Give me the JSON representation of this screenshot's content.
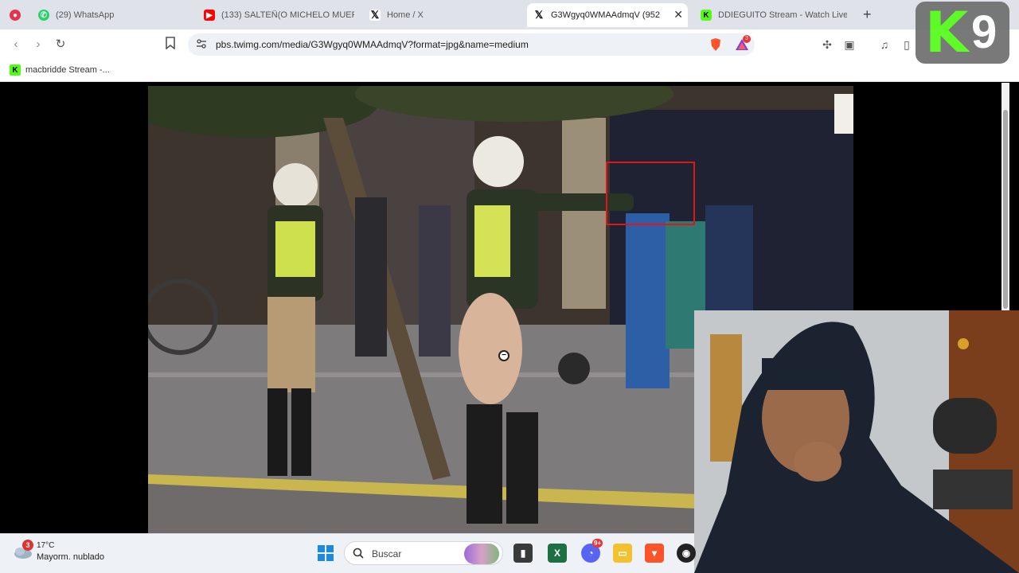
{
  "tabs": [
    {
      "label": "",
      "icon": "record-icon",
      "color": "#e8344a"
    },
    {
      "label": "(29) WhatsApp",
      "icon": "whatsapp-icon",
      "color": "#25d366"
    },
    {
      "label": "(133) SALTEÑ(O MICHELO MUER",
      "icon": "youtube-icon",
      "color": "#ff0000"
    },
    {
      "label": "Home / X",
      "icon": "x-icon",
      "color": "#000000"
    },
    {
      "label": "G3Wgyq0WMAAdmqV (952",
      "icon": "x-icon",
      "color": "#000000",
      "active": true
    },
    {
      "label": "DDIEGUITO Stream - Watch Live",
      "icon": "kick-icon",
      "color": "#53fc18"
    }
  ],
  "toolbar": {
    "url": "pbs.twimg.com/media/G3Wgyq0WMAAdmqV?format=jpg&name=medium",
    "brave_badge": "3"
  },
  "bookmarks": [
    {
      "label": "macbridde Stream -...",
      "icon": "kick-icon"
    }
  ],
  "overlay": {
    "logo_letter": "K",
    "logo_number": "9"
  },
  "taskbar": {
    "weather_badge": "3",
    "temperature": "17°C",
    "weather_desc": "Mayorm. nublado",
    "search_placeholder": "Buscar",
    "discord_badge": "9+"
  },
  "colors": {
    "accent_kick": "#53fc18",
    "highlight_box": "#e01515",
    "tab_strip": "#dfe3e9"
  }
}
